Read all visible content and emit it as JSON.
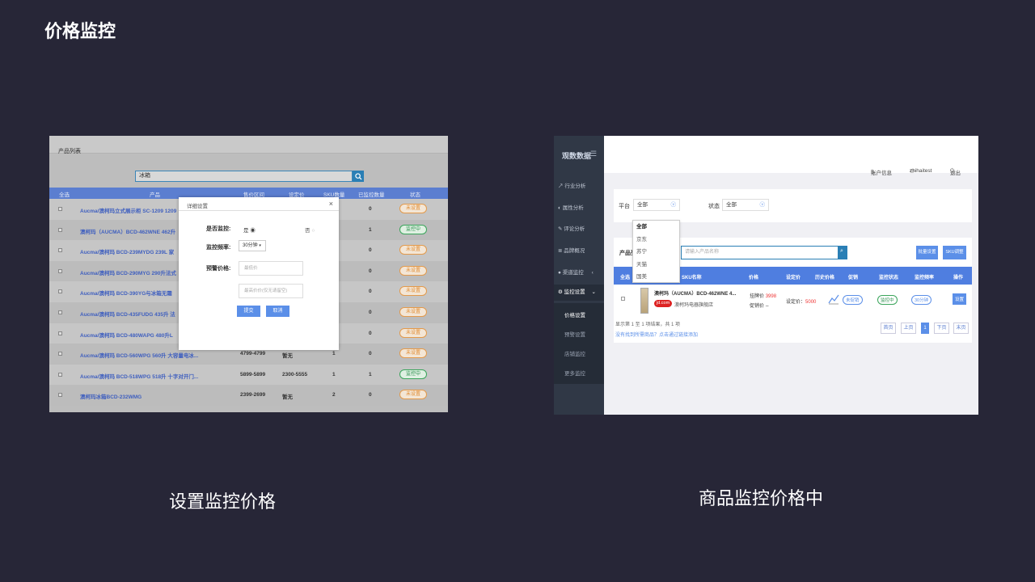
{
  "slide": {
    "title": "价格监控",
    "caption_left": "设置监控价格",
    "caption_right": "商品监控价格中"
  },
  "left_screen": {
    "product_list_label": "产品列表",
    "search_value": "冰箱",
    "columns": [
      "全选",
      "产品",
      "售价区间",
      "设定价",
      "SKU数量",
      "已监控数量",
      "状态"
    ],
    "rows": [
      {
        "name": "Aucma/澳柯玛立式展示柜 SC-1209 1209",
        "range": "",
        "set": "",
        "sku": "",
        "monitored": "0",
        "status": "未设置",
        "state": "off"
      },
      {
        "name": "澳柯玛（AUCMA）BCD-462WNE 462升",
        "range": "",
        "set": "",
        "sku": "",
        "monitored": "1",
        "status": "监控中",
        "state": "on"
      },
      {
        "name": "Aucma/澳柯玛 BCD-239MYDG 239L 家",
        "range": "",
        "set": "",
        "sku": "",
        "monitored": "0",
        "status": "未设置",
        "state": "off"
      },
      {
        "name": "Aucma/澳柯玛 BCD-290MYG 290升法式",
        "range": "",
        "set": "",
        "sku": "",
        "monitored": "0",
        "status": "未设置",
        "state": "off"
      },
      {
        "name": "Aucma/澳柯玛 BCD-390YG与冰箱无霜",
        "range": "",
        "set": "",
        "sku": "",
        "monitored": "0",
        "status": "未设置",
        "state": "off"
      },
      {
        "name": "Aucma/澳柯玛 BCD-435FUDG 435升 法",
        "range": "",
        "set": "",
        "sku": "",
        "monitored": "0",
        "status": "未设置",
        "state": "off"
      },
      {
        "name": "Aucma/澳柯玛 BCD-480WAPG 480升L",
        "range": "",
        "set": "",
        "sku": "",
        "monitored": "0",
        "status": "未设置",
        "state": "off"
      },
      {
        "name": "Aucma/澳柯玛 BCD-560WPG 560升 大容量电冰...",
        "range": "4799-4799",
        "set": "暂无",
        "sku": "1",
        "monitored": "0",
        "status": "未设置",
        "state": "off"
      },
      {
        "name": "Aucma/澳柯玛 BCD-518WPG 518升 十字对开门...",
        "range": "5899-5899",
        "set": "2300-5555",
        "sku": "1",
        "monitored": "1",
        "status": "监控中",
        "state": "on"
      },
      {
        "name": "澳柯玛冰箱BCD-232WMG",
        "range": "2399-2699",
        "set": "暂无",
        "sku": "2",
        "monitored": "0",
        "status": "未设置",
        "state": "off"
      }
    ],
    "dialog": {
      "title": "详细设置",
      "close": "×",
      "monitor_label": "是否监控:",
      "yes": "是",
      "no": "否",
      "freq_label": "监控频率:",
      "freq_value": "30分钟",
      "alert_label": "预警价格:",
      "low_placeholder": "最低价",
      "high_placeholder": "最高价价(仅无请留空)",
      "submit": "提交",
      "cancel": "取消"
    }
  },
  "right_screen": {
    "brand": "观数数据",
    "menu": [
      "行业分析",
      "属性分析",
      "评论分析",
      "品牌概况",
      "渠道监控",
      "监控设置"
    ],
    "submenu": [
      "价格设置",
      "预警设置",
      "店铺监控",
      "更多监控"
    ],
    "topbar": {
      "account": "账户信息",
      "user": "zhihaitest",
      "logout": "退出"
    },
    "filter": {
      "platform_label": "平台",
      "platform_value": "全部",
      "status_label": "状态",
      "status_value": "全部"
    },
    "dropdown": [
      "全部",
      "京东",
      "苏宁",
      "天猫",
      "国美"
    ],
    "list": {
      "label": "产品列表",
      "search_placeholder": "请输入产品名称",
      "batch_btn": "批量设置",
      "sku_btn": "SKU调整",
      "columns": [
        "全选",
        "SKU名称",
        "价格",
        "设定价",
        "历史价格",
        "促销",
        "监控状态",
        "监控频率",
        "操作"
      ],
      "row": {
        "name": "澳柯玛（AUCMA）BCD-462WNE 4...",
        "platform": "jd.com",
        "store": "澳柯玛电器旗舰店",
        "price_label": "挂牌价",
        "price": "3998",
        "promo_label": "促销价",
        "promo": "--",
        "set_label": "设定价：",
        "set_value": "5000",
        "promo_status": "未促销",
        "monitor_status": "监控中",
        "freq": "30分钟",
        "action": "设置"
      },
      "summary": "显示第 1 至 1 项结果，共 1 项",
      "link": "没有找到所需商品？点击通过链接添加",
      "pager": [
        "首页",
        "上页",
        "1",
        "下页",
        "末页"
      ]
    }
  },
  "colors": {
    "background": "#272637",
    "accent": "#5b7ed0",
    "on": "#3aa55b",
    "off": "#e39a4b"
  }
}
